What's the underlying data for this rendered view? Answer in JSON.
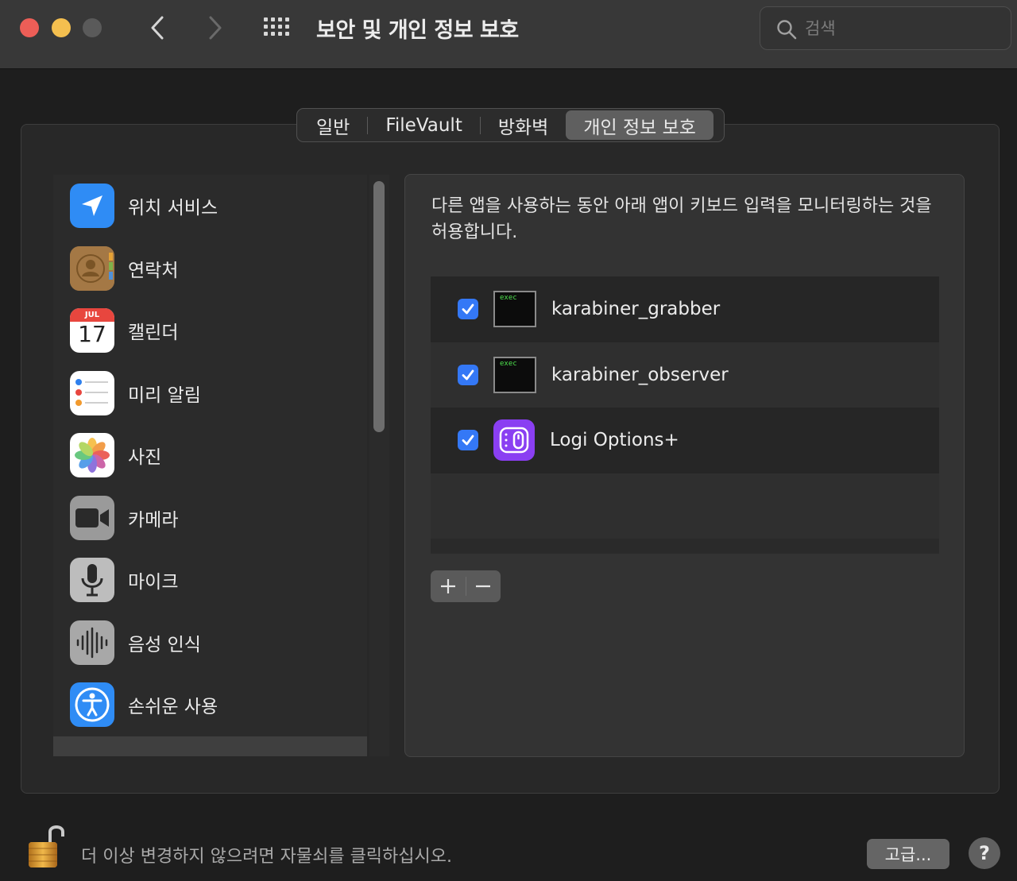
{
  "window": {
    "title": "보안 및 개인 정보 보호",
    "search_placeholder": "검색"
  },
  "tabs": [
    {
      "label": "일반",
      "active": false
    },
    {
      "label": "FileVault",
      "active": false
    },
    {
      "label": "방화벽",
      "active": false
    },
    {
      "label": "개인 정보 보호",
      "active": true
    }
  ],
  "sidebar": {
    "items": [
      {
        "label": "위치 서비스",
        "icon": "location-arrow-icon"
      },
      {
        "label": "연락처",
        "icon": "contacts-icon"
      },
      {
        "label": "캘린더",
        "icon": "calendar-icon",
        "calendar_month": "JUL",
        "calendar_day": "17"
      },
      {
        "label": "미리 알림",
        "icon": "reminders-icon"
      },
      {
        "label": "사진",
        "icon": "photos-icon"
      },
      {
        "label": "카메라",
        "icon": "camera-icon"
      },
      {
        "label": "마이크",
        "icon": "microphone-icon"
      },
      {
        "label": "음성 인식",
        "icon": "speech-recognition-icon"
      },
      {
        "label": "손쉬운 사용",
        "icon": "accessibility-icon"
      }
    ]
  },
  "detail": {
    "description": "다른 앱을 사용하는 동안 아래 앱이 키보드 입력을 모니터링하는 것을 허용합니다.",
    "apps": [
      {
        "name": "karabiner_grabber",
        "checked": true,
        "icon": "exec-terminal-icon",
        "icon_text": "exec"
      },
      {
        "name": "karabiner_observer",
        "checked": true,
        "icon": "exec-terminal-icon",
        "icon_text": "exec"
      },
      {
        "name": "Logi Options+",
        "checked": true,
        "icon": "logi-options-icon"
      }
    ],
    "add_label": "+",
    "remove_label": "−"
  },
  "footer": {
    "lock_text": "더 이상 변경하지 않으려면 자물쇠를 클릭하십시오.",
    "advanced_label": "고급...",
    "help_label": "?"
  },
  "colors": {
    "accent": "#3478f6",
    "window_bg": "#1e1e1e",
    "titlebar_bg": "#383838"
  }
}
